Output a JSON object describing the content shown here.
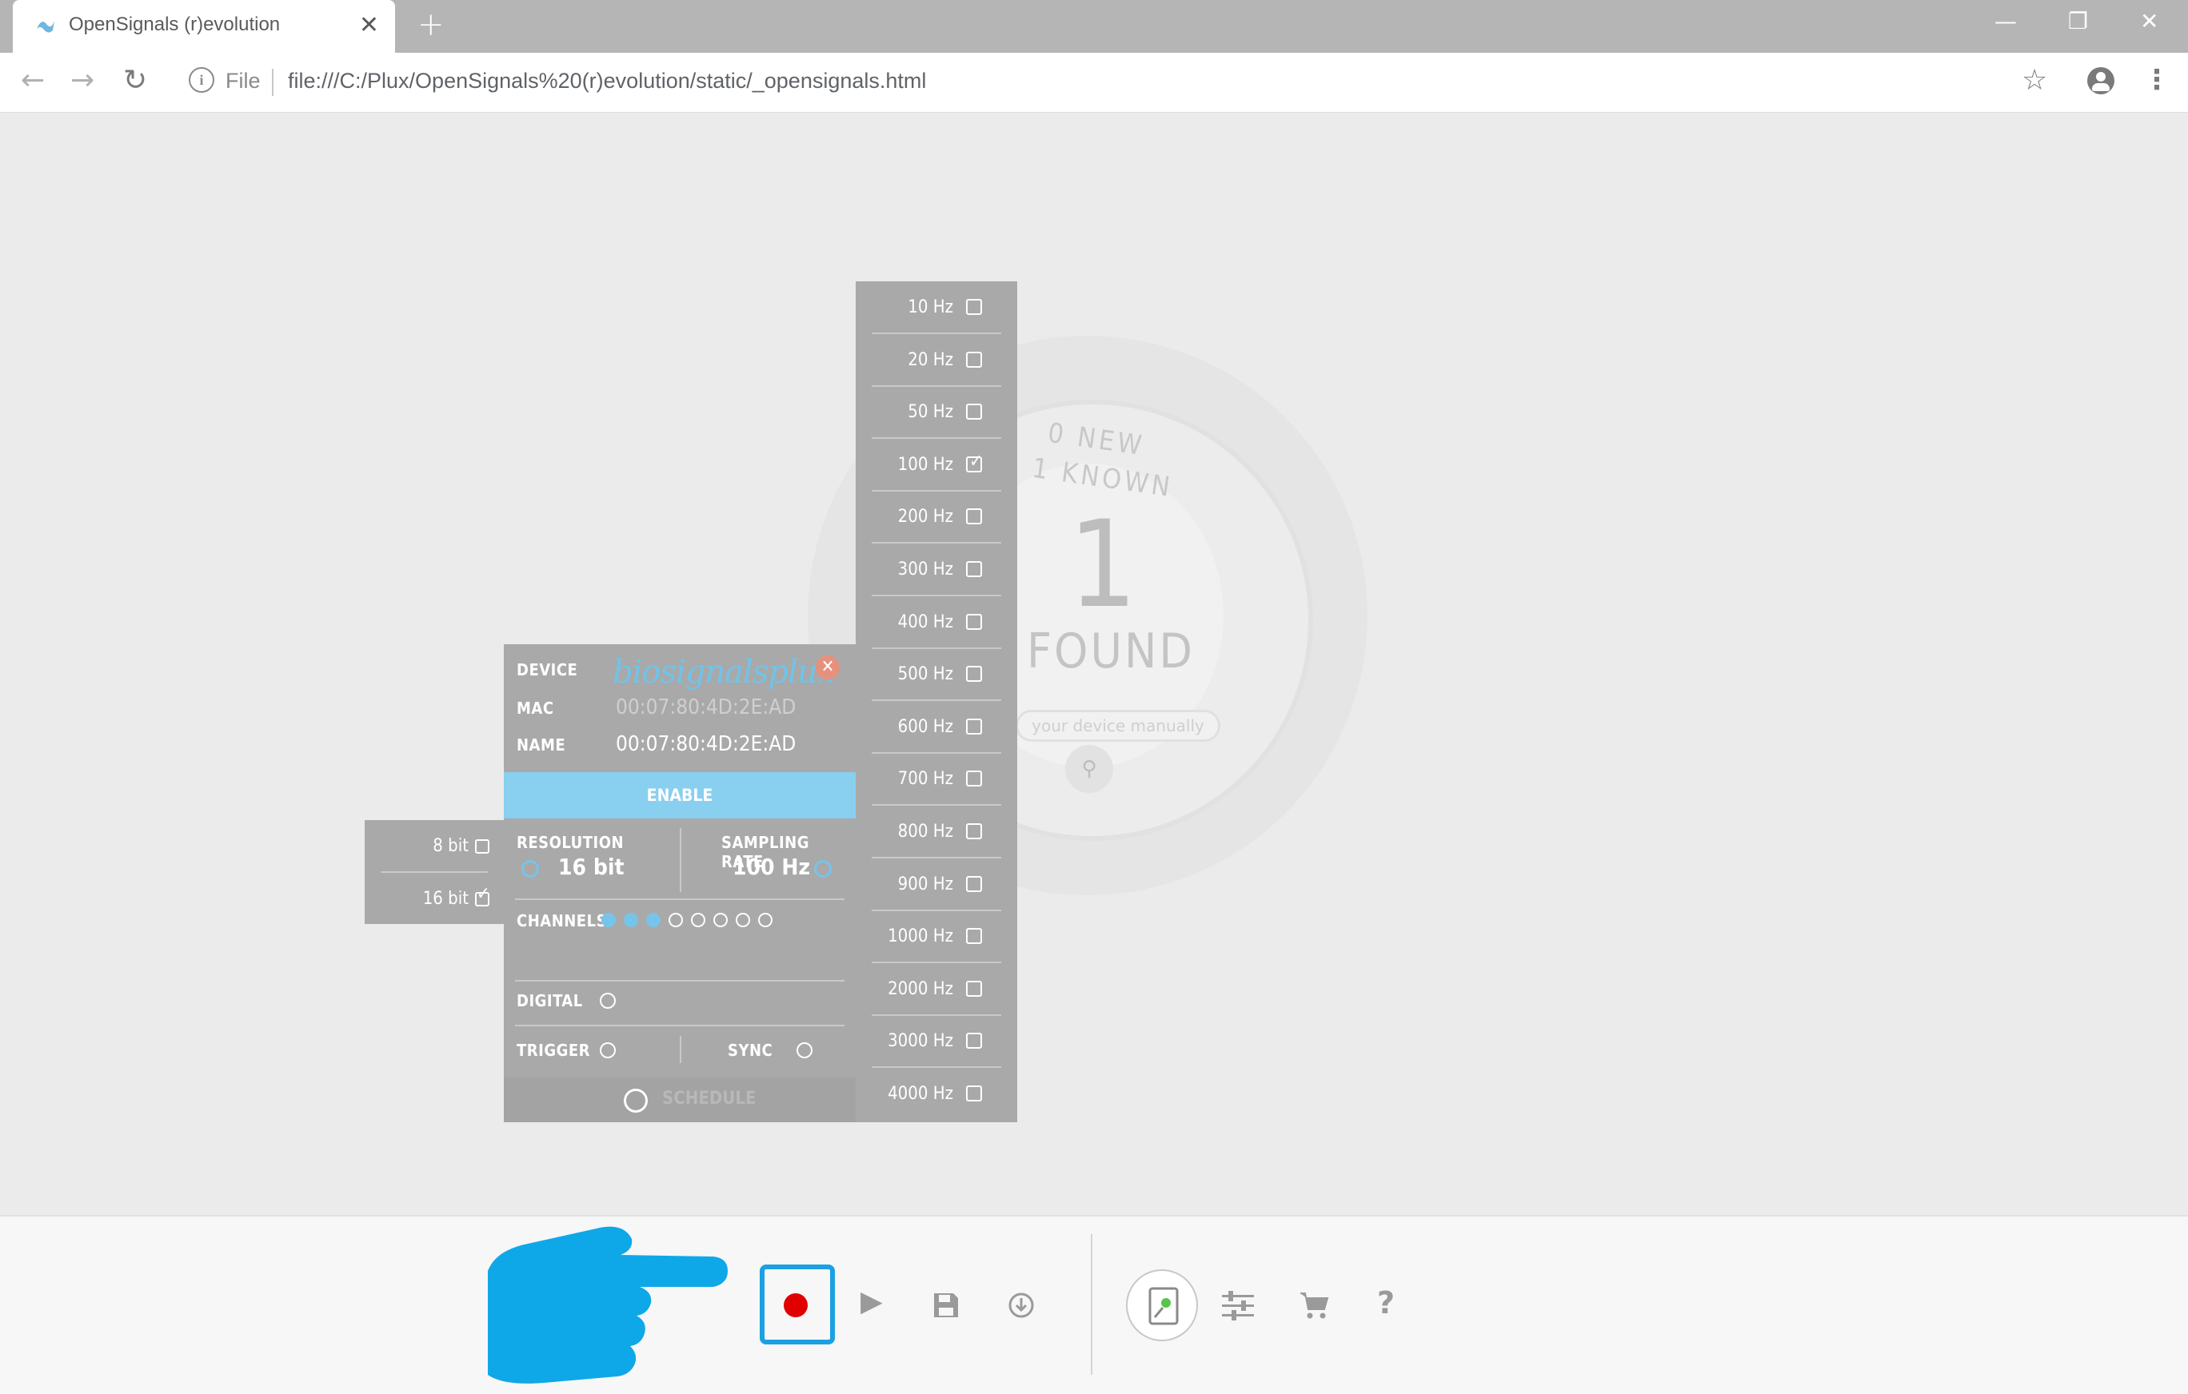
{
  "browser": {
    "tab_title": "OpenSignals (r)evolution",
    "tab_close": "✕",
    "new_tab": "+",
    "file_label": "File",
    "url": "file:///C:/Plux/OpenSignals%20(r)evolution/static/_opensignals.html",
    "window": {
      "minimize": "—",
      "restore": "❐",
      "close": "✕"
    },
    "nav": {
      "back": "←",
      "forward": "→",
      "reload": "↻"
    },
    "star": "☆",
    "menu": "⋮"
  },
  "background": {
    "new_label": "0 NEW",
    "known_label": "1 KNOWN",
    "count": "1",
    "found_label": "FOUND",
    "input_placeholder": "your device manually"
  },
  "device": {
    "device_label": "DEVICE",
    "brand": "biosignalsplux",
    "mac_label": "MAC",
    "mac_value": "00:07:80:4D:2E:AD",
    "name_label": "NAME",
    "name_value": "00:07:80:4D:2E:AD",
    "enable_label": "ENABLE",
    "resolution_label": "RESOLUTION",
    "resolution_value": "16 bit",
    "sampling_label": "SAMPLING RATE",
    "sampling_value": "100 Hz",
    "channels_label": "CHANNELS",
    "channels_active": 3,
    "channels_total": 8,
    "digital_label": "DIGITAL",
    "trigger_label": "TRIGGER",
    "sync_label": "SYNC",
    "schedule_label": "SCHEDULE"
  },
  "resolution_options": [
    {
      "label": "8 bit",
      "checked": false
    },
    {
      "label": "16 bit",
      "checked": true
    }
  ],
  "sampling_options": [
    {
      "label": "10 Hz",
      "checked": false
    },
    {
      "label": "20 Hz",
      "checked": false
    },
    {
      "label": "50 Hz",
      "checked": false
    },
    {
      "label": "100 Hz",
      "checked": true
    },
    {
      "label": "200 Hz",
      "checked": false
    },
    {
      "label": "300 Hz",
      "checked": false
    },
    {
      "label": "400 Hz",
      "checked": false
    },
    {
      "label": "500 Hz",
      "checked": false
    },
    {
      "label": "600 Hz",
      "checked": false
    },
    {
      "label": "700 Hz",
      "checked": false
    },
    {
      "label": "800 Hz",
      "checked": false
    },
    {
      "label": "900 Hz",
      "checked": false
    },
    {
      "label": "1000 Hz",
      "checked": false
    },
    {
      "label": "2000 Hz",
      "checked": false
    },
    {
      "label": "3000 Hz",
      "checked": false
    },
    {
      "label": "4000 Hz",
      "checked": false
    }
  ],
  "toolbar": {
    "play": "▶",
    "help": "?"
  },
  "colors": {
    "accent": "#1ba0e2",
    "enable_bg": "#89cff0",
    "record_dot": "#e00000",
    "panel_bg": "#a9a9a9",
    "hand": "#0ea8e8"
  }
}
